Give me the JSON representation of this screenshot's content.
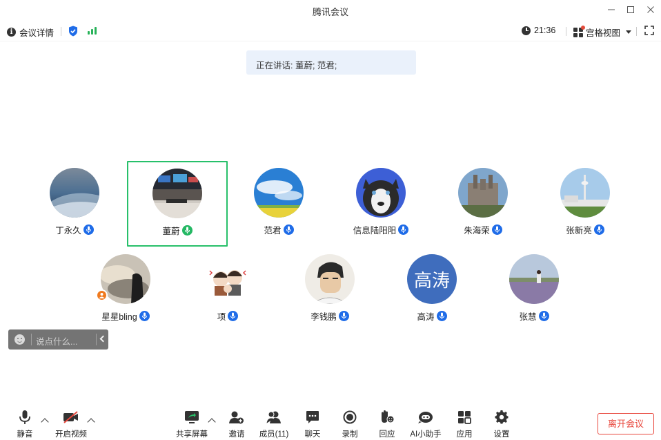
{
  "window": {
    "title": "腾讯会议"
  },
  "infobar": {
    "meeting_details_label": "会议详情",
    "time": "21:36",
    "view_mode_label": "宫格视图"
  },
  "speaking_banner": "正在讲话: 董蔚; 范君;",
  "participants": [
    {
      "name": "丁永久",
      "mic": "blue",
      "active": false
    },
    {
      "name": "董蔚",
      "mic": "green",
      "active": true
    },
    {
      "name": "范君",
      "mic": "blue",
      "active": false
    },
    {
      "name": "信息陆阳阳",
      "mic": "blue",
      "active": false
    },
    {
      "name": "朱海荣",
      "mic": "blue",
      "active": false
    },
    {
      "name": "张新亮",
      "mic": "blue",
      "active": false
    },
    {
      "name": "星星bling",
      "mic": "blue",
      "active": false,
      "host": true
    },
    {
      "name": "项",
      "mic": "blue",
      "active": false
    },
    {
      "name": "李钱鹏",
      "mic": "blue",
      "active": false
    },
    {
      "name": "高涛",
      "mic": "blue",
      "active": false,
      "avatar_text": "高涛"
    },
    {
      "name": "张慧",
      "mic": "blue",
      "active": false
    }
  ],
  "quick_chat": {
    "placeholder": "说点什么..."
  },
  "toolbar": {
    "mute": "静音",
    "start_video": "开启视频",
    "share_screen": "共享屏幕",
    "invite": "邀请",
    "members": "成员(11)",
    "chat": "聊天",
    "record": "录制",
    "react": "回应",
    "ai_assistant": "AI小助手",
    "apps": "应用",
    "settings": "设置",
    "leave": "离开会议"
  },
  "colors": {
    "accent_blue": "#1f6ce8",
    "speaking_green": "#27c06a",
    "leave_red": "#e8463b",
    "banner_bg": "#eaf1fb"
  }
}
